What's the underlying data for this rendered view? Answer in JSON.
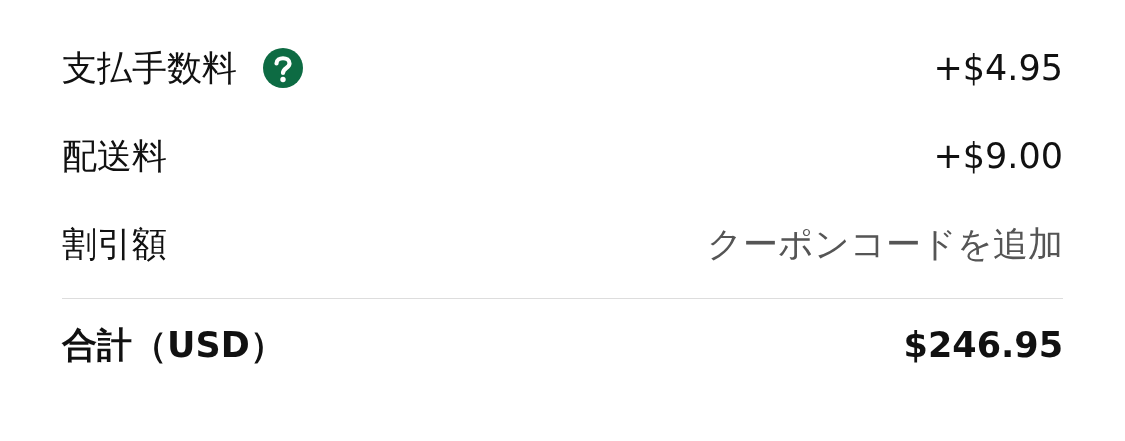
{
  "rows": [
    {
      "label": "支払手数料",
      "help": true,
      "kind": "amount",
      "value": "+$4.95"
    },
    {
      "label": "配送料",
      "help": false,
      "kind": "amount",
      "value": "+$9.00"
    },
    {
      "label": "割引額",
      "help": false,
      "kind": "link",
      "value": "クーポンコードを追加"
    }
  ],
  "total": {
    "label": "合計（USD）",
    "value": "$246.95"
  }
}
